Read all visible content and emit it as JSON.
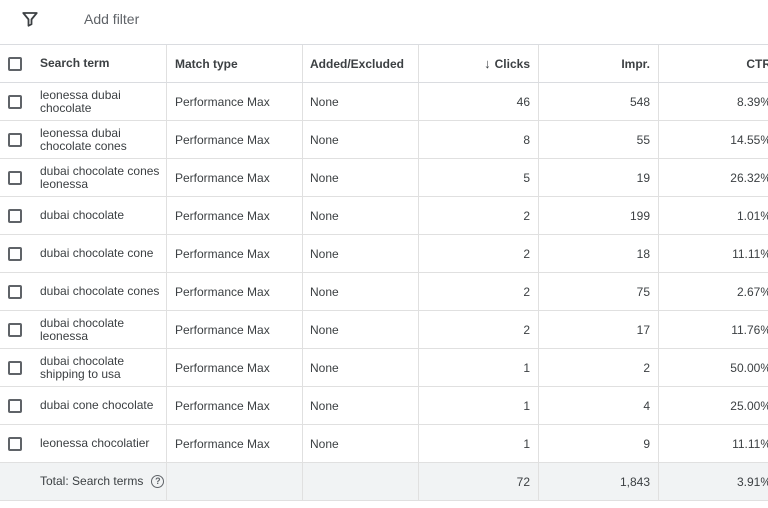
{
  "filterbar": {
    "add_filter_label": "Add filter"
  },
  "table": {
    "headers": {
      "search_term": "Search term",
      "match_type": "Match type",
      "added_excluded": "Added/Excluded",
      "clicks": "Clicks",
      "impr": "Impr.",
      "ctr": "CTR"
    },
    "sort_indicator": "↓",
    "rows": [
      {
        "term": "leonessa dubai chocolate",
        "match": "Performance Max",
        "added": "None",
        "clicks": "46",
        "impr": "548",
        "ctr": "8.39%"
      },
      {
        "term": "leonessa dubai chocolate cones",
        "match": "Performance Max",
        "added": "None",
        "clicks": "8",
        "impr": "55",
        "ctr": "14.55%"
      },
      {
        "term": "dubai chocolate cones leonessa",
        "match": "Performance Max",
        "added": "None",
        "clicks": "5",
        "impr": "19",
        "ctr": "26.32%"
      },
      {
        "term": "dubai chocolate",
        "match": "Performance Max",
        "added": "None",
        "clicks": "2",
        "impr": "199",
        "ctr": "1.01%"
      },
      {
        "term": "dubai chocolate cone",
        "match": "Performance Max",
        "added": "None",
        "clicks": "2",
        "impr": "18",
        "ctr": "11.11%"
      },
      {
        "term": "dubai chocolate cones",
        "match": "Performance Max",
        "added": "None",
        "clicks": "2",
        "impr": "75",
        "ctr": "2.67%"
      },
      {
        "term": "dubai chocolate leonessa",
        "match": "Performance Max",
        "added": "None",
        "clicks": "2",
        "impr": "17",
        "ctr": "11.76%"
      },
      {
        "term": "dubai chocolate shipping to usa",
        "match": "Performance Max",
        "added": "None",
        "clicks": "1",
        "impr": "2",
        "ctr": "50.00%"
      },
      {
        "term": "dubai cone chocolate",
        "match": "Performance Max",
        "added": "None",
        "clicks": "1",
        "impr": "4",
        "ctr": "25.00%"
      },
      {
        "term": "leonessa chocolatier",
        "match": "Performance Max",
        "added": "None",
        "clicks": "1",
        "impr": "9",
        "ctr": "11.11%"
      }
    ],
    "total": {
      "label": "Total: Search terms",
      "help_glyph": "?",
      "clicks": "72",
      "impr": "1,843",
      "ctr": "3.91%"
    }
  },
  "icons": {
    "filter": "filter-icon",
    "help": "help-circle-icon",
    "sort": "arrow-down-icon"
  }
}
